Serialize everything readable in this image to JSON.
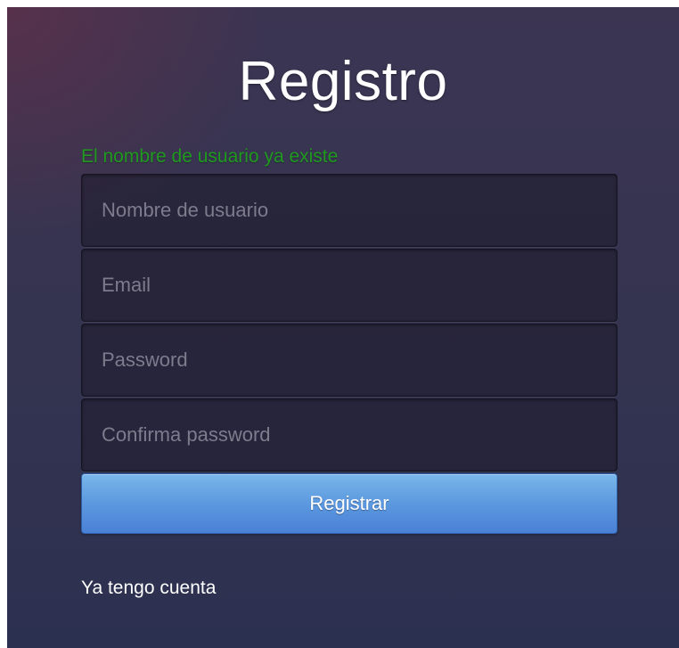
{
  "form": {
    "title": "Registro",
    "error_message": "El nombre de usuario ya existe",
    "fields": [
      {
        "name": "username",
        "placeholder": "Nombre de usuario",
        "value": ""
      },
      {
        "name": "email",
        "placeholder": "Email",
        "value": ""
      },
      {
        "name": "password",
        "placeholder": "Password",
        "value": ""
      },
      {
        "name": "confirm_password",
        "placeholder": "Confirma password",
        "value": ""
      }
    ],
    "submit_label": "Registrar",
    "login_link": "Ya tengo cuenta"
  },
  "colors": {
    "error_text": "#1f9a1f",
    "button_top": "#79b7ea",
    "button_bottom": "#4a80d6",
    "background": "#343450"
  }
}
